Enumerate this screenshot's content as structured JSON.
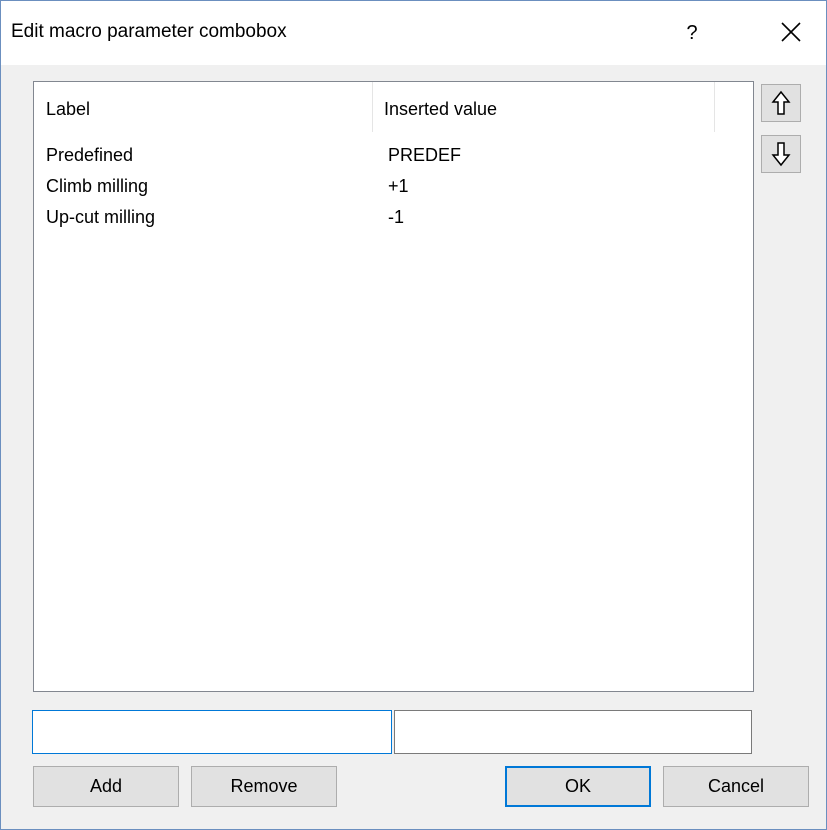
{
  "window": {
    "title": "Edit macro parameter combobox",
    "help_label": "?",
    "close_icon": "close-icon"
  },
  "list": {
    "columns": [
      "Label",
      "Inserted value"
    ],
    "rows": [
      {
        "label": "Predefined",
        "value": "PREDEF"
      },
      {
        "label": "Climb milling",
        "value": "+1"
      },
      {
        "label": "Up-cut milling",
        "value": "-1"
      }
    ]
  },
  "side_buttons": {
    "up_icon": "arrow-up-icon",
    "down_icon": "arrow-down-icon"
  },
  "inputs": {
    "label_value": "",
    "inserted_value": ""
  },
  "buttons": {
    "add": "Add",
    "remove": "Remove",
    "ok": "OK",
    "cancel": "Cancel"
  },
  "colors": {
    "focus_border": "#0078d7",
    "button_face": "#e1e1e1",
    "dialog_bg": "#f0f0f0"
  }
}
